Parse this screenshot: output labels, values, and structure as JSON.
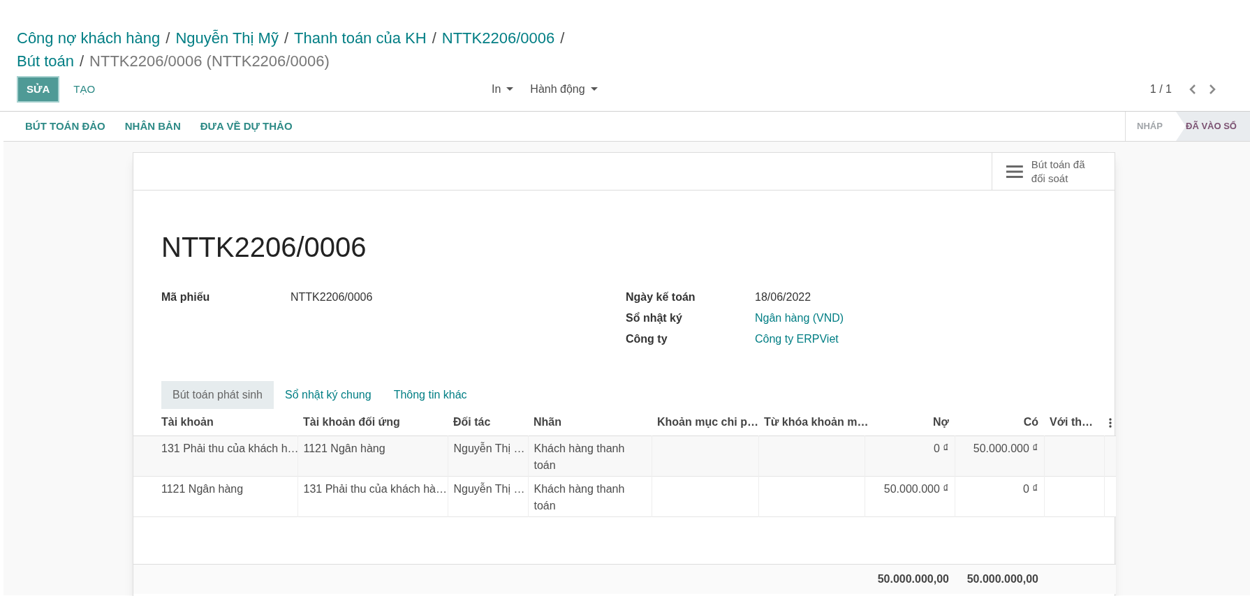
{
  "breadcrumbs": [
    {
      "label": "Công nợ khách hàng",
      "link": true
    },
    {
      "label": "Nguyễn Thị Mỹ",
      "link": true
    },
    {
      "label": "Thanh toán của KH",
      "link": true
    },
    {
      "label": "NTTK2206/0006",
      "link": true
    },
    {
      "label": "Bút toán",
      "link": true
    },
    {
      "label": "NTTK2206/0006 (NTTK2206/0006)",
      "link": false
    }
  ],
  "breadcrumb_separator": "/",
  "buttons": [
    {
      "label": "SỬA",
      "kind": "primary"
    },
    {
      "label": "TẠO",
      "kind": "link"
    }
  ],
  "dropdowns": [
    "In",
    "Hành động"
  ],
  "pager": "1 / 1",
  "header_buttons": [
    "BÚT TOÁN ĐẢO",
    "NHÂN BẢN",
    "ĐƯA VỀ DỰ THẢO"
  ],
  "status_steps": [
    {
      "label": "NHÁP",
      "selected": false
    },
    {
      "label": "ĐÃ VÀO SỔ",
      "selected": true
    }
  ],
  "smart_button": "Bút toán đã đối soát",
  "title": "NTTK2206/0006",
  "fields_left": [
    {
      "label": "Mã phiếu",
      "value": "NTTK2206/0006",
      "link": false
    }
  ],
  "fields_right": [
    {
      "label": "Ngày kế toán",
      "value": "18/06/2022",
      "link": false
    },
    {
      "label": "Sổ nhật ký",
      "value": "Ngân hàng (VND)",
      "link": true
    },
    {
      "label": "Công ty",
      "value": "Công ty ERPViet",
      "link": true
    }
  ],
  "tabs": [
    {
      "label": "Bút toán phát sinh",
      "selected": true
    },
    {
      "label": "Sổ nhật ký chung",
      "selected": false
    },
    {
      "label": "Thông tin khác",
      "selected": false
    }
  ],
  "table": {
    "columns": [
      {
        "label": "Tài khoản",
        "kind": "text"
      },
      {
        "label": "Tài khoản đối ứng",
        "kind": "text"
      },
      {
        "label": "Đối tác",
        "kind": "text"
      },
      {
        "label": "Nhãn",
        "kind": "text"
      },
      {
        "label": "Khoản mục chi p…",
        "kind": "text"
      },
      {
        "label": "Từ khóa khoản m…",
        "kind": "text"
      },
      {
        "label": "Nợ",
        "kind": "amount"
      },
      {
        "label": "Có",
        "kind": "amount"
      },
      {
        "label": "Với th…",
        "kind": "text"
      }
    ],
    "rows": [
      [
        "131 Phải thu của khách h…",
        "1121 Ngân hàng",
        "Nguyễn Thị …",
        "Khách hàng thanh toán",
        null,
        null,
        "0 ₫",
        "50.000.000 ₫",
        null
      ],
      [
        "1121 Ngân hàng",
        "131 Phải thu của khách hà…",
        "Nguyễn Thị …",
        "Khách hàng thanh toán",
        null,
        null,
        "50.000.000 ₫",
        "0 ₫",
        null
      ]
    ],
    "totals": {
      "debit": "50.000.000,00",
      "credit": "50.000.000,00"
    }
  }
}
